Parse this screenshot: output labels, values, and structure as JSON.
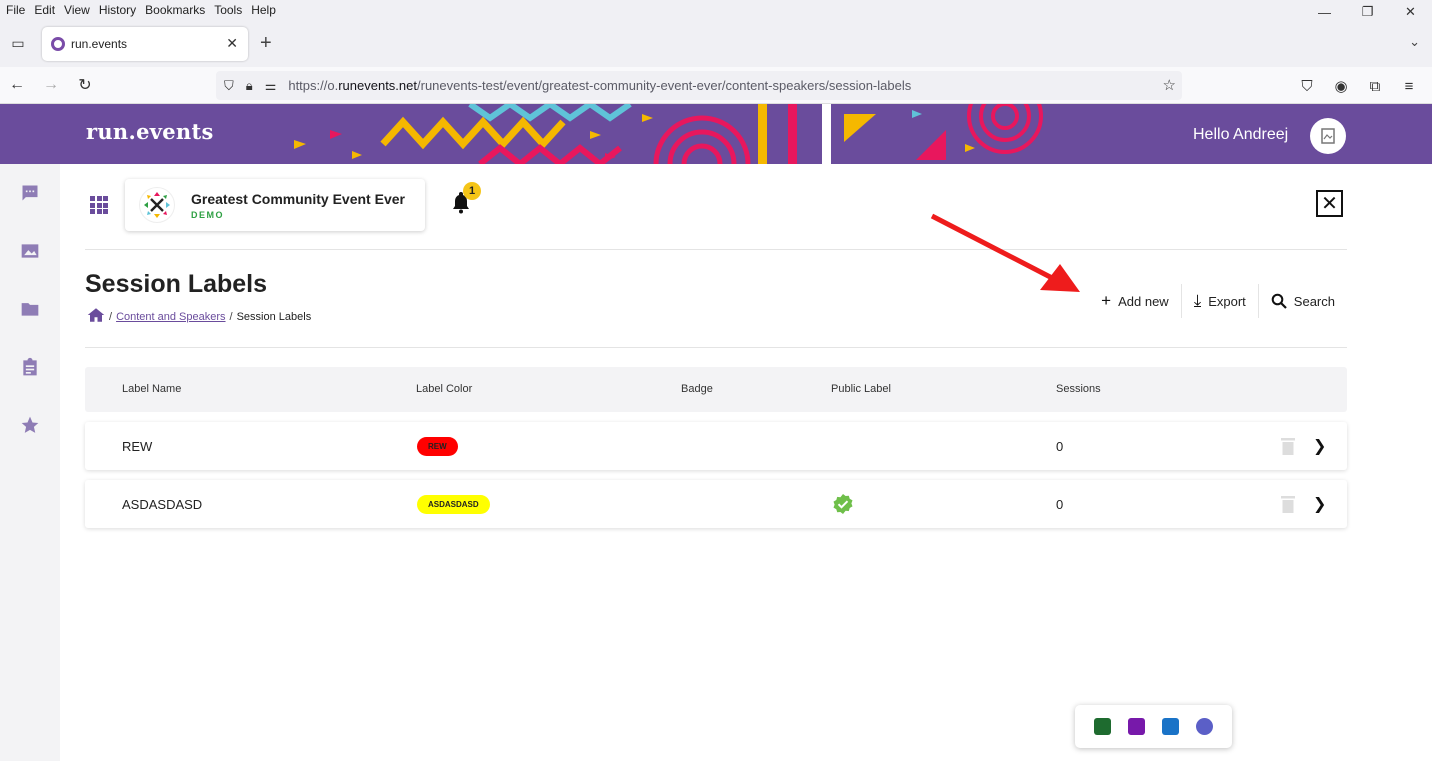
{
  "browser": {
    "menu": [
      "File",
      "Edit",
      "View",
      "History",
      "Bookmarks",
      "Tools",
      "Help"
    ],
    "tab_title": "run.events",
    "url_prefix": "https://o.",
    "url_domain": "runevents.net",
    "url_path": "/runevents-test/event/greatest-community-event-ever/content-speakers/session-labels"
  },
  "header": {
    "brand": "run.events",
    "greeting": "Hello Andreej"
  },
  "event": {
    "name": "Greatest Community Event Ever",
    "tag": "DEMO",
    "notifications": "1"
  },
  "page": {
    "title": "Session Labels",
    "breadcrumb_link": "Content and Speakers",
    "breadcrumb_current": "Session Labels"
  },
  "actions": {
    "add_new": "Add new",
    "export": "Export",
    "search": "Search"
  },
  "table": {
    "columns": [
      "Label Name",
      "Label Color",
      "Badge",
      "Public Label",
      "Sessions"
    ],
    "rows": [
      {
        "name": "REW",
        "label": "REW",
        "color": "#ff0000",
        "public": false,
        "sessions": "0"
      },
      {
        "name": "ASDASDASD",
        "label": "ASDASDASD",
        "color": "#ffff00",
        "public": true,
        "sessions": "0"
      }
    ]
  },
  "colors": {
    "brand_purple": "#6a4c9c",
    "check_green": "#6fbf4a"
  }
}
